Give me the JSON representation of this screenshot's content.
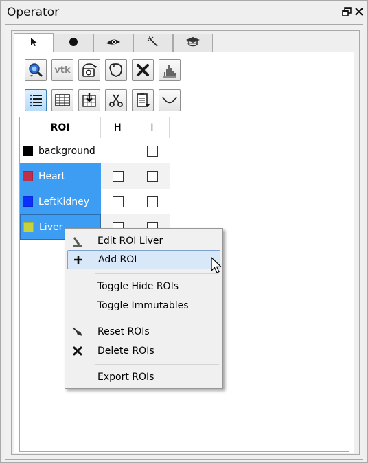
{
  "window": {
    "title": "Operator",
    "float_icon": "float-icon",
    "close_icon": "close-icon"
  },
  "tabs": [
    {
      "icon": "pointer-icon",
      "active": true
    },
    {
      "icon": "circle-icon",
      "active": false
    },
    {
      "icon": "eye-icon",
      "active": false
    },
    {
      "icon": "magic-wand-icon",
      "active": false
    },
    {
      "icon": "graduation-cap-icon",
      "active": false
    }
  ],
  "toolbar": {
    "row1": [
      "search-roi-icon",
      "vtk-icon",
      "camera-rotate-icon",
      "lasso-icon",
      "delete-icon",
      "histogram-icon"
    ],
    "vtk_label": "vtk",
    "row2": [
      "list-icon",
      "table-icon",
      "import-icon",
      "scissors-icon",
      "clipboard-icon",
      "curve-icon"
    ]
  },
  "table": {
    "headers": {
      "roi": "ROI",
      "h": "H",
      "i": "I"
    },
    "rows": [
      {
        "name": "background",
        "color": "#000000",
        "selected": false,
        "h": null,
        "i": false
      },
      {
        "name": "Heart",
        "color": "#c0304a",
        "selected": true,
        "h": false,
        "i": false
      },
      {
        "name": "LeftKidney",
        "color": "#0a2fff",
        "selected": true,
        "h": false,
        "i": false
      },
      {
        "name": "Liver",
        "color": "#c8d23a",
        "selected": true,
        "h": false,
        "i": false
      }
    ]
  },
  "context_menu": {
    "items": [
      {
        "label": "Edit ROI Liver",
        "icon": "pencil-icon"
      },
      {
        "label": "Add ROI",
        "icon": "plus-icon",
        "hover": true
      },
      {
        "label": "Toggle Hide ROIs",
        "icon": ""
      },
      {
        "label": "Toggle Immutables",
        "icon": ""
      },
      {
        "label": "Reset ROIs",
        "icon": "broom-icon"
      },
      {
        "label": "Delete ROIs",
        "icon": "x-icon"
      },
      {
        "label": "Export ROIs",
        "icon": ""
      }
    ]
  },
  "colors": {
    "selection": "#3d9df3",
    "menu_hover": "#d9e8f8"
  }
}
